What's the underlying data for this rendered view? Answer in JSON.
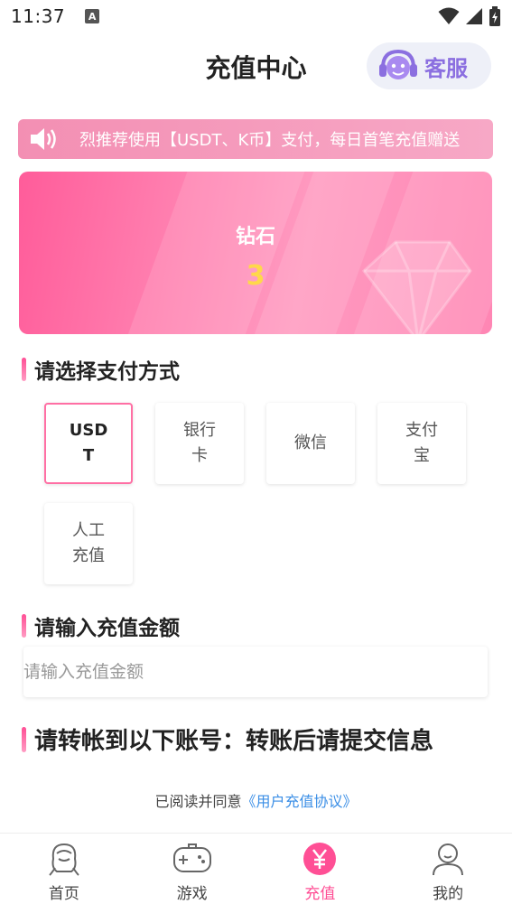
{
  "status_bar": {
    "time": "11:37",
    "badge": "A"
  },
  "header": {
    "title": "充值中心",
    "service_label": "客服"
  },
  "notice": {
    "text": "烈推荐使用【USDT、K币】支付，每日首笔充值赠送"
  },
  "balance": {
    "label": "钻石",
    "value": "3"
  },
  "payment": {
    "title": "请选择支付方式",
    "options": [
      {
        "label": "USDT",
        "selected": true
      },
      {
        "label": "银行卡",
        "selected": false
      },
      {
        "label": "微信",
        "selected": false
      },
      {
        "label": "支付宝",
        "selected": false
      },
      {
        "label": "人工充值",
        "selected": false
      }
    ]
  },
  "amount": {
    "title": "请输入充值金额",
    "placeholder": "请输入充值金额",
    "value": ""
  },
  "transfer": {
    "title": "请转帐到以下账号：转账后请提交信息"
  },
  "agreement": {
    "prefix": "已阅读并同意",
    "link": "《用户充值协议》"
  },
  "nav": {
    "items": [
      {
        "label": "首页",
        "icon": "home-icon",
        "active": false
      },
      {
        "label": "游戏",
        "icon": "gamepad-icon",
        "active": false
      },
      {
        "label": "充值",
        "icon": "yuan-icon",
        "active": true
      },
      {
        "label": "我的",
        "icon": "user-icon",
        "active": false
      }
    ]
  },
  "colors": {
    "accent": "#ff4f95",
    "balance_value": "#ffd84a",
    "service_text": "#8b6fe0",
    "link": "#3a8ee6"
  }
}
